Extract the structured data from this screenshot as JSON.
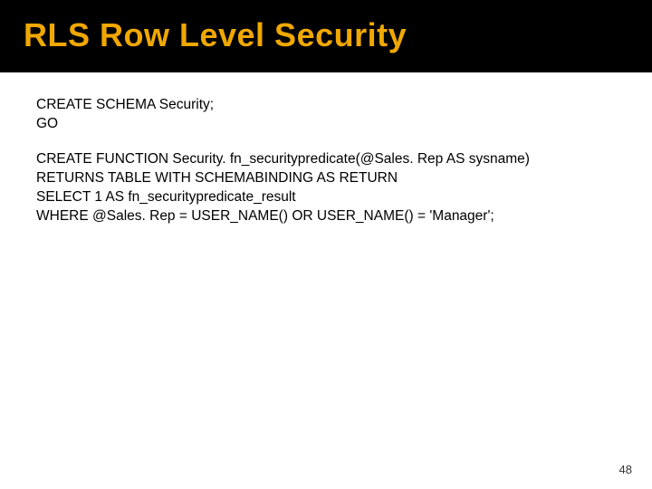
{
  "header": {
    "title": "RLS Row Level Security"
  },
  "code": {
    "block1": {
      "line1": "CREATE SCHEMA Security;",
      "line2": "GO"
    },
    "block2": {
      "line1": "CREATE FUNCTION Security. fn_securitypredicate(@Sales. Rep AS sysname)",
      "line2": "RETURNS TABLE WITH SCHEMABINDING AS RETURN",
      "line3": "SELECT 1 AS fn_securitypredicate_result",
      "line4": "WHERE @Sales. Rep = USER_NAME() OR USER_NAME() = 'Manager';"
    }
  },
  "page_number": "48"
}
